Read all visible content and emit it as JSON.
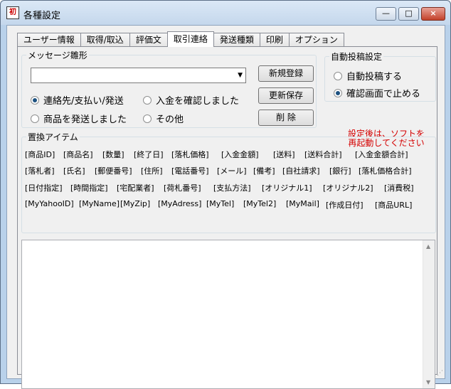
{
  "window": {
    "title": "各種設定",
    "icon": "app-icon-kanji",
    "icon_text": "初"
  },
  "window_controls": {
    "minimize": "—",
    "maximize": "□",
    "close": "×"
  },
  "tabs": [
    {
      "label": "ユーザー情報",
      "active": false
    },
    {
      "label": "取得/取込",
      "active": false
    },
    {
      "label": "評価文",
      "active": false
    },
    {
      "label": "取引連絡",
      "active": true
    },
    {
      "label": "発送種類",
      "active": false
    },
    {
      "label": "印刷",
      "active": false
    },
    {
      "label": "オプション",
      "active": false
    }
  ],
  "message_group": {
    "label": "メッセージ雛形",
    "combo_value": "",
    "radios": [
      {
        "label": "連絡先/支払い/発送",
        "checked": true
      },
      {
        "label": "入金を確認しました",
        "checked": false
      },
      {
        "label": "商品を発送しました",
        "checked": false
      },
      {
        "label": "その他",
        "checked": false
      }
    ]
  },
  "buttons": {
    "new": "新規登録",
    "update": "更新保存",
    "delete": "削 除"
  },
  "auto_post_group": {
    "label": "自動投稿設定",
    "radios": [
      {
        "label": "自動投稿する",
        "checked": false
      },
      {
        "label": "確認画面で止める",
        "checked": true
      }
    ]
  },
  "notice": {
    "line1": "設定後は、ソフトを",
    "line2": "再起動してください",
    "color": "#d40000"
  },
  "replace_group": {
    "label": "置換アイテム",
    "rows": [
      [
        "[商品ID]",
        "[商品名]",
        "[数量]",
        "[終了日]",
        "[落札価格]",
        "[入金金額]",
        "[送料]",
        "[送料合計]",
        "[入金金額合計]"
      ],
      [
        "[落札者]",
        "[氏名]",
        "[郵便番号]",
        "[住所]",
        "[電話番号]",
        "[メール]",
        "[備考]",
        "[自社請求]",
        "[銀行]",
        "[落札価格合計]"
      ],
      [
        "[日付指定]",
        "[時間指定]",
        "[宅配業者]",
        "[荷札番号]",
        "[支払方法]",
        "[オリジナル1]",
        "[オリジナル2]",
        "[消費税]"
      ],
      [
        "[MyYahooID]",
        "[MyName]",
        "[MyZip]",
        "[MyAdress]",
        "[MyTel]",
        "[MyTel2]",
        "[MyMail]",
        "[作成日付]",
        "[商品URL]"
      ]
    ]
  },
  "editor": {
    "content": ""
  }
}
